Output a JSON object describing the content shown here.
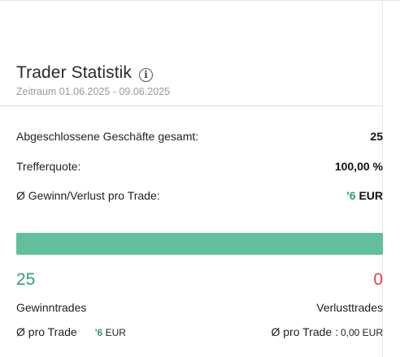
{
  "header": {
    "title": "Trader Statistik",
    "period_label": "Zeitraum 01.06.2025 - 09.06.2025"
  },
  "stats": [
    {
      "label": "Abgeschlossene Geschäfte gesamt:",
      "value": "25"
    },
    {
      "label": "Trefferquote:",
      "value": "100,00 %"
    },
    {
      "label": "Ø Gewinn/Verlust pro Trade:",
      "value_partial": "'6",
      "value_unit": "EUR"
    }
  ],
  "win_loss": {
    "win_fraction": 1.0,
    "win_count": "25",
    "loss_count": "0",
    "win_label": "Gewinntrades",
    "loss_label": "Verlusttrades",
    "win_avg_label": "Ø pro Trade",
    "win_avg_partial": "'6",
    "win_avg_unit": "EUR",
    "loss_avg_label": "Ø pro Trade :",
    "loss_avg_value": "0,00 EUR"
  },
  "colors": {
    "positive": "#2e9b78",
    "negative": "#e0424b",
    "bar": "#62bf9c"
  }
}
